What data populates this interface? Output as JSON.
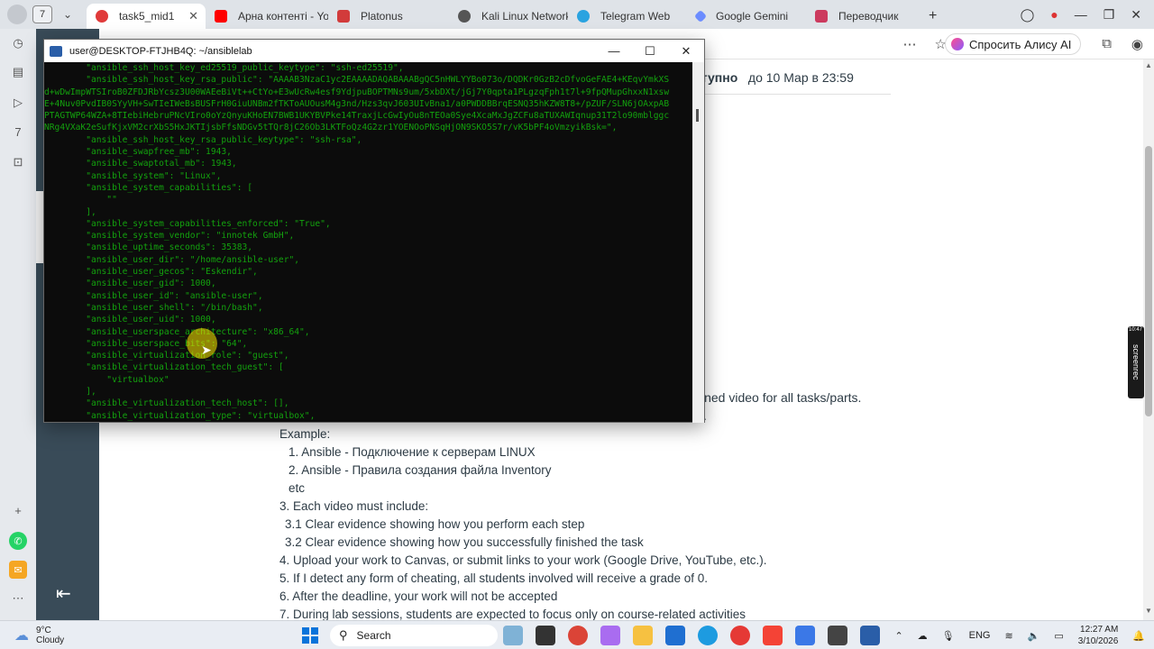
{
  "browser": {
    "tab_count": "7",
    "tabs": [
      {
        "label": "task5_mid1",
        "color": "#e03a3a",
        "active": true
      },
      {
        "label": "Арна контенті - Yo",
        "color": "#ff0000"
      },
      {
        "label": "Platonus",
        "color": "#d23b3b"
      },
      {
        "label": "Kali Linux Networki",
        "color": "#555555"
      },
      {
        "label": "Telegram Web",
        "color": "#2aa3e0"
      },
      {
        "label": "Google Gemini",
        "color": "#6b8cff"
      },
      {
        "label": "Переводчик",
        "color": "#cc3a5e"
      }
    ],
    "new_tab": "+",
    "alice_label": "Спросить Алису AI"
  },
  "page": {
    "availability_prefix": "ступно",
    "availability_date": "до 10 Мар в 23:59",
    "frag_line": "ined video for all tasks/parts.",
    "frag_line2": ".",
    "example_label": "Example:",
    "example_1": "1. Ansible - Подключение к серверам LINUX",
    "example_2": "2. Ansible - Правила создания файла Inventory",
    "example_etc": "etc",
    "item_3": "3. Each video must include:",
    "item_3_1": "3.1 Clear evidence showing how you perform each step",
    "item_3_2": "3.2 Clear evidence showing how you successfully finished the task",
    "item_4": "4. Upload your work to Canvas, or submit links to your work (Google Drive, YouTube, etc.).",
    "item_5": "5. If I detect any form of cheating, all students involved will receive a grade of 0.",
    "item_6": "6. After the deadline, your work will not be accepted",
    "item_7": "7. During lab sessions, students are expected to focus only on course-related activities"
  },
  "screenrec": {
    "label": "screenrec",
    "time": "10:47"
  },
  "terminal": {
    "title": "user@DESKTOP-FTJHB4Q: ~/ansiblelab",
    "lines": [
      "        \"ansible_ssh_host_key_ed25519_public_keytype\": \"ssh-ed25519\",",
      "        \"ansible_ssh_host_key_rsa_public\": \"AAAAB3NzaC1yc2EAAAADAQABAAABgQC5nHWLYYBo073o/DQDKr0GzB2cDfvoGeFAE4+KEqvYmkXS",
      "d+wDwImpWTSIroB0ZFDJRbYcsz3U00WAEeBiVt++CtYo+E3wUcRw4esf9YdjpuBOPTMNs9um/5xbDXt/jGj7Y0qpta1PLgzqFph1t7l+9fpQMupGhxxN1xsw",
      "E+4Nuv0PvdIB0SYyVH+SwTIeIWeBsBUSFrH0GiuUNBm2fTKToAUOusM4g3nd/Hzs3qvJ603UIvBna1/a0PWDDBBrqESNQ35hKZW8T8+/pZUF/SLN6jOAxpAB",
      "PTAGTWP64WZA+8TIebiHebruPNcVIro0oYzQnyuKHoEN7BWB1UKYBVPke14TraxjLcGwIyOu8nTEOa0Sye4XcaMxJgZCFu8aTUXAWIqnup31T2lo90mblggc",
      "NRg4VXaK2eSufKjxVM2crXbS5HxJKTIjsbFfsNDGv5tTQr8jC26Ob3LKTFoQz4G2zr1YOENOoPNSqHjON9SKO5S7r/vK5bPF4oVmzyikBsk=\",",
      "        \"ansible_ssh_host_key_rsa_public_keytype\": \"ssh-rsa\",",
      "        \"ansible_swapfree_mb\": 1943,",
      "        \"ansible_swaptotal_mb\": 1943,",
      "        \"ansible_system\": \"Linux\",",
      "        \"ansible_system_capabilities\": [",
      "            \"\"",
      "        ],",
      "        \"ansible_system_capabilities_enforced\": \"True\",",
      "        \"ansible_system_vendor\": \"innotek GmbH\",",
      "        \"ansible_uptime_seconds\": 35383,",
      "        \"ansible_user_dir\": \"/home/ansible-user\",",
      "        \"ansible_user_gecos\": \"Eskendir\",",
      "        \"ansible_user_gid\": 1000,",
      "        \"ansible_user_id\": \"ansible-user\",",
      "        \"ansible_user_shell\": \"/bin/bash\",",
      "        \"ansible_user_uid\": 1000,",
      "        \"ansible_userspace_architecture\": \"x86_64\",",
      "        \"ansible_userspace_bits\": \"64\",",
      "        \"ansible_virtualization_role\": \"guest\",",
      "        \"ansible_virtualization_tech_guest\": [",
      "            \"virtualbox\"",
      "        ],",
      "        \"ansible_virtualization_tech_host\": [],",
      "        \"ansible_virtualization_type\": \"virtualbox\","
    ]
  },
  "taskbar": {
    "temperature": "9°C",
    "weather": "Cloudy",
    "search_placeholder": "Search",
    "language": "ENG",
    "time": "12:27 AM",
    "date": "3/10/2026"
  },
  "colors": {
    "terminal_text": "#13a10e",
    "canvas_nav": "#394b58",
    "accent_windows": "#0a74da"
  }
}
